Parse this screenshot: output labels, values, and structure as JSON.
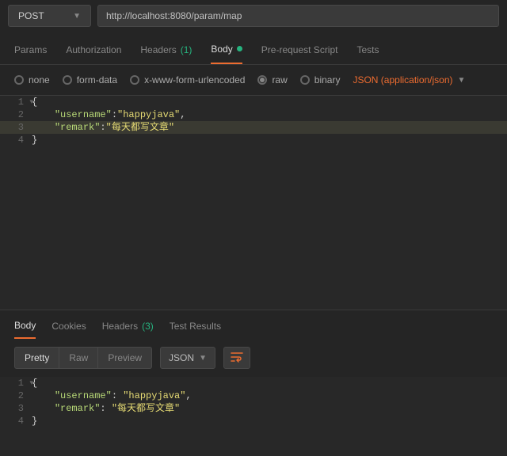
{
  "request": {
    "method": "POST",
    "url": "http://localhost:8080/param/map"
  },
  "tabs": {
    "params": "Params",
    "authorization": "Authorization",
    "headers": "Headers",
    "headers_count": "(1)",
    "body": "Body",
    "prerequest": "Pre-request Script",
    "tests": "Tests"
  },
  "body_types": {
    "none": "none",
    "form_data": "form-data",
    "urlencoded": "x-www-form-urlencoded",
    "raw": "raw",
    "binary": "binary"
  },
  "content_type_label": "JSON (application/json)",
  "request_body": {
    "lines": [
      {
        "n": "1",
        "indent": "",
        "tokens": [
          {
            "t": "brace",
            "v": "{"
          }
        ],
        "fold": true
      },
      {
        "n": "2",
        "indent": "    ",
        "tokens": [
          {
            "t": "key",
            "v": "\"username\""
          },
          {
            "t": "punct",
            "v": ":"
          },
          {
            "t": "str",
            "v": "\"happyjava\""
          },
          {
            "t": "punct",
            "v": ","
          }
        ]
      },
      {
        "n": "3",
        "indent": "    ",
        "tokens": [
          {
            "t": "key",
            "v": "\"remark\""
          },
          {
            "t": "punct",
            "v": ":"
          },
          {
            "t": "str",
            "v": "\"每天都写文章\""
          }
        ],
        "highlighted": true
      },
      {
        "n": "4",
        "indent": "",
        "tokens": [
          {
            "t": "brace",
            "v": "}"
          }
        ]
      }
    ]
  },
  "response_tabs": {
    "body": "Body",
    "cookies": "Cookies",
    "headers": "Headers",
    "headers_count": "(3)",
    "test_results": "Test Results"
  },
  "view_modes": {
    "pretty": "Pretty",
    "raw": "Raw",
    "preview": "Preview"
  },
  "format_label": "JSON",
  "response_body": {
    "lines": [
      {
        "n": "1",
        "indent": "",
        "tokens": [
          {
            "t": "brace",
            "v": "{"
          }
        ],
        "fold": true
      },
      {
        "n": "2",
        "indent": "    ",
        "tokens": [
          {
            "t": "key",
            "v": "\"username\""
          },
          {
            "t": "punct",
            "v": ": "
          },
          {
            "t": "str",
            "v": "\"happyjava\""
          },
          {
            "t": "punct",
            "v": ","
          }
        ]
      },
      {
        "n": "3",
        "indent": "    ",
        "tokens": [
          {
            "t": "key",
            "v": "\"remark\""
          },
          {
            "t": "punct",
            "v": ": "
          },
          {
            "t": "str",
            "v": "\"每天都写文章\""
          }
        ]
      },
      {
        "n": "4",
        "indent": "",
        "tokens": [
          {
            "t": "brace",
            "v": "}"
          }
        ]
      }
    ]
  }
}
